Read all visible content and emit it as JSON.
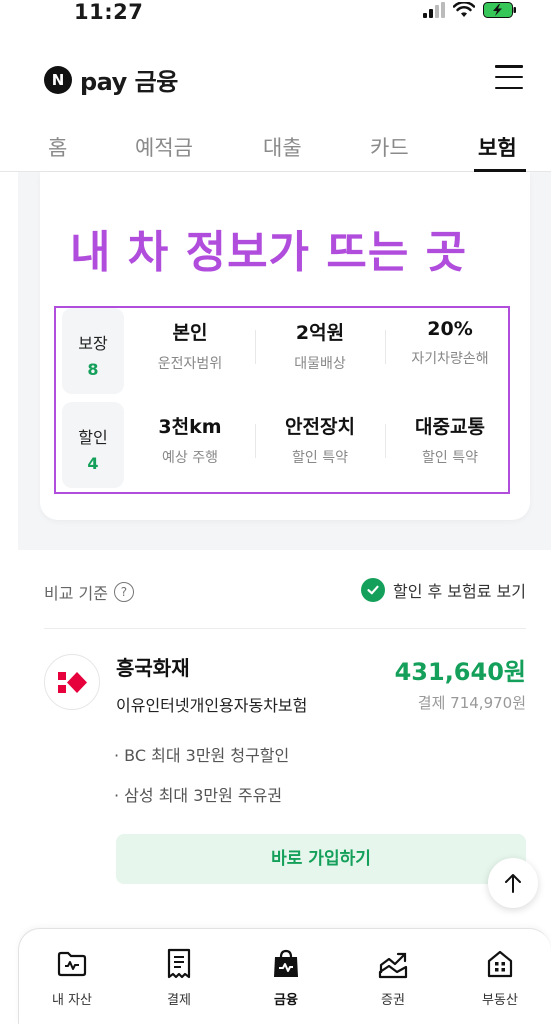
{
  "status_bar": {
    "time": "11:27"
  },
  "header": {
    "logo_n": "N",
    "logo_text": "pay 금융"
  },
  "tabs": [
    {
      "label": "홈"
    },
    {
      "label": "예적금"
    },
    {
      "label": "대출"
    },
    {
      "label": "카드"
    },
    {
      "label": "보험",
      "active": true
    }
  ],
  "card": {
    "headline": "내 차 정보가 뜨는 곳",
    "rows": [
      {
        "label": "보장",
        "count": "8",
        "cells": [
          {
            "value": "본인",
            "sub": "운전자범위"
          },
          {
            "value": "2억원",
            "sub": "대물배상"
          },
          {
            "value": "20%",
            "sub": "자기차량손해"
          }
        ]
      },
      {
        "label": "할인",
        "count": "4",
        "cells": [
          {
            "value": "3천km",
            "sub": "예상 주행"
          },
          {
            "value": "안전장치",
            "sub": "할인 특약"
          },
          {
            "value": "대중교통",
            "sub": "할인 특약"
          }
        ]
      }
    ]
  },
  "compare": {
    "basis_label": "비교 기준",
    "toggle_label": "할인 후 보험료 보기"
  },
  "offer": {
    "insurer": "흥국화재",
    "product": "이유인터넷개인용자동차보험",
    "price": "431,640원",
    "original_price": "결제 714,970원",
    "benefits": [
      "· BC 최대 3만원 청구할인",
      "· 삼성 최대 3만원 주유권"
    ],
    "join_button": "바로 가입하기"
  },
  "bottom_nav": [
    {
      "label": "내 자산",
      "icon": "asset-folder-icon"
    },
    {
      "label": "결제",
      "icon": "receipt-icon"
    },
    {
      "label": "금융",
      "icon": "finance-bag-icon",
      "active": true
    },
    {
      "label": "증권",
      "icon": "stock-chart-icon"
    },
    {
      "label": "부동산",
      "icon": "building-icon"
    }
  ],
  "colors": {
    "accent_green": "#14a05a",
    "annotation_purple": "#b14ddc",
    "brand_red": "#e6003c"
  }
}
